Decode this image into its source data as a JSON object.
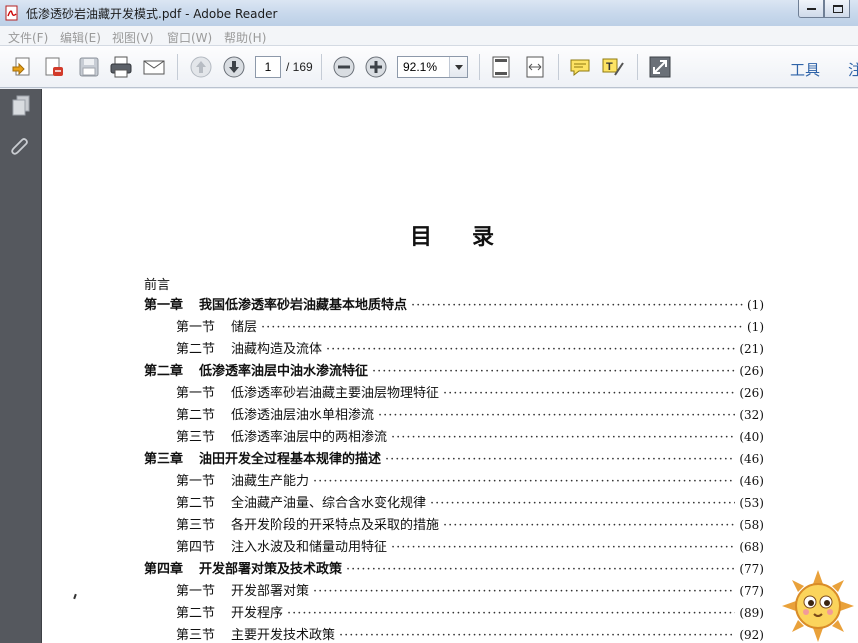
{
  "window": {
    "title": "低渗透砂岩油藏开发模式.pdf - Adobe Reader"
  },
  "menu": {
    "items": [
      "文件(F)",
      "编辑(E)",
      "视图(V)",
      "窗口(W)",
      "帮助(H)"
    ]
  },
  "toolbar": {
    "page_current": "1",
    "page_total": "/ 169",
    "zoom": "92.1%",
    "tools_label": "工具",
    "more_label": "注",
    "icons": [
      "create-pdf-icon",
      "export-pdf-icon",
      "save-icon",
      "print-icon",
      "email-icon",
      "page-up-icon",
      "page-down-icon",
      "zoom-out-icon",
      "zoom-in-icon",
      "fit-page-icon",
      "fit-width-icon",
      "comment-icon",
      "highlight-text-icon",
      "fullscreen-icon"
    ]
  },
  "document": {
    "heading": "目录",
    "foreword": "前言",
    "toc": [
      {
        "label": "第一章",
        "title": "我国低渗透率砂岩油藏基本地质特点",
        "page": "(1)",
        "level": 1
      },
      {
        "label": "第一节",
        "title": "储层",
        "page": "(1)",
        "level": 2
      },
      {
        "label": "第二节",
        "title": "油藏构造及流体",
        "page": "(21)",
        "level": 2
      },
      {
        "label": "第二章",
        "title": "低渗透率油层中油水渗流特征",
        "page": "(26)",
        "level": 1
      },
      {
        "label": "第一节",
        "title": "低渗透率砂岩油藏主要油层物理特征",
        "page": "(26)",
        "level": 2
      },
      {
        "label": "第二节",
        "title": "低渗透油层油水单相渗流",
        "page": "(32)",
        "level": 2
      },
      {
        "label": "第三节",
        "title": "低渗透率油层中的两相渗流",
        "page": "(40)",
        "level": 2
      },
      {
        "label": "第三章",
        "title": "油田开发全过程基本规律的描述",
        "page": "(46)",
        "level": 1
      },
      {
        "label": "第一节",
        "title": "油藏生产能力",
        "page": "(46)",
        "level": 2
      },
      {
        "label": "第二节",
        "title": "全油藏产油量、综合含水变化规律",
        "page": "(53)",
        "level": 2
      },
      {
        "label": "第三节",
        "title": "各开发阶段的开采特点及采取的措施",
        "page": "(58)",
        "level": 2
      },
      {
        "label": "第四节",
        "title": "注入水波及和储量动用特征",
        "page": "(68)",
        "level": 2
      },
      {
        "label": "第四章",
        "title": "开发部署对策及技术政策",
        "page": "(77)",
        "level": 1
      },
      {
        "label": "第一节",
        "title": "开发部署对策",
        "page": "(77)",
        "level": 2
      },
      {
        "label": "第二节",
        "title": "开发程序",
        "page": "(89)",
        "level": 2
      },
      {
        "label": "第三节",
        "title": "主要开发技术政策",
        "page": "(92)",
        "level": 2
      }
    ]
  },
  "left_panel": {
    "icons": [
      "page-thumbnails-icon",
      "attachments-icon"
    ]
  },
  "colors": {
    "accent": "#2f63a8",
    "panel": "#55585e",
    "titlebar": "#c9d9ec"
  }
}
